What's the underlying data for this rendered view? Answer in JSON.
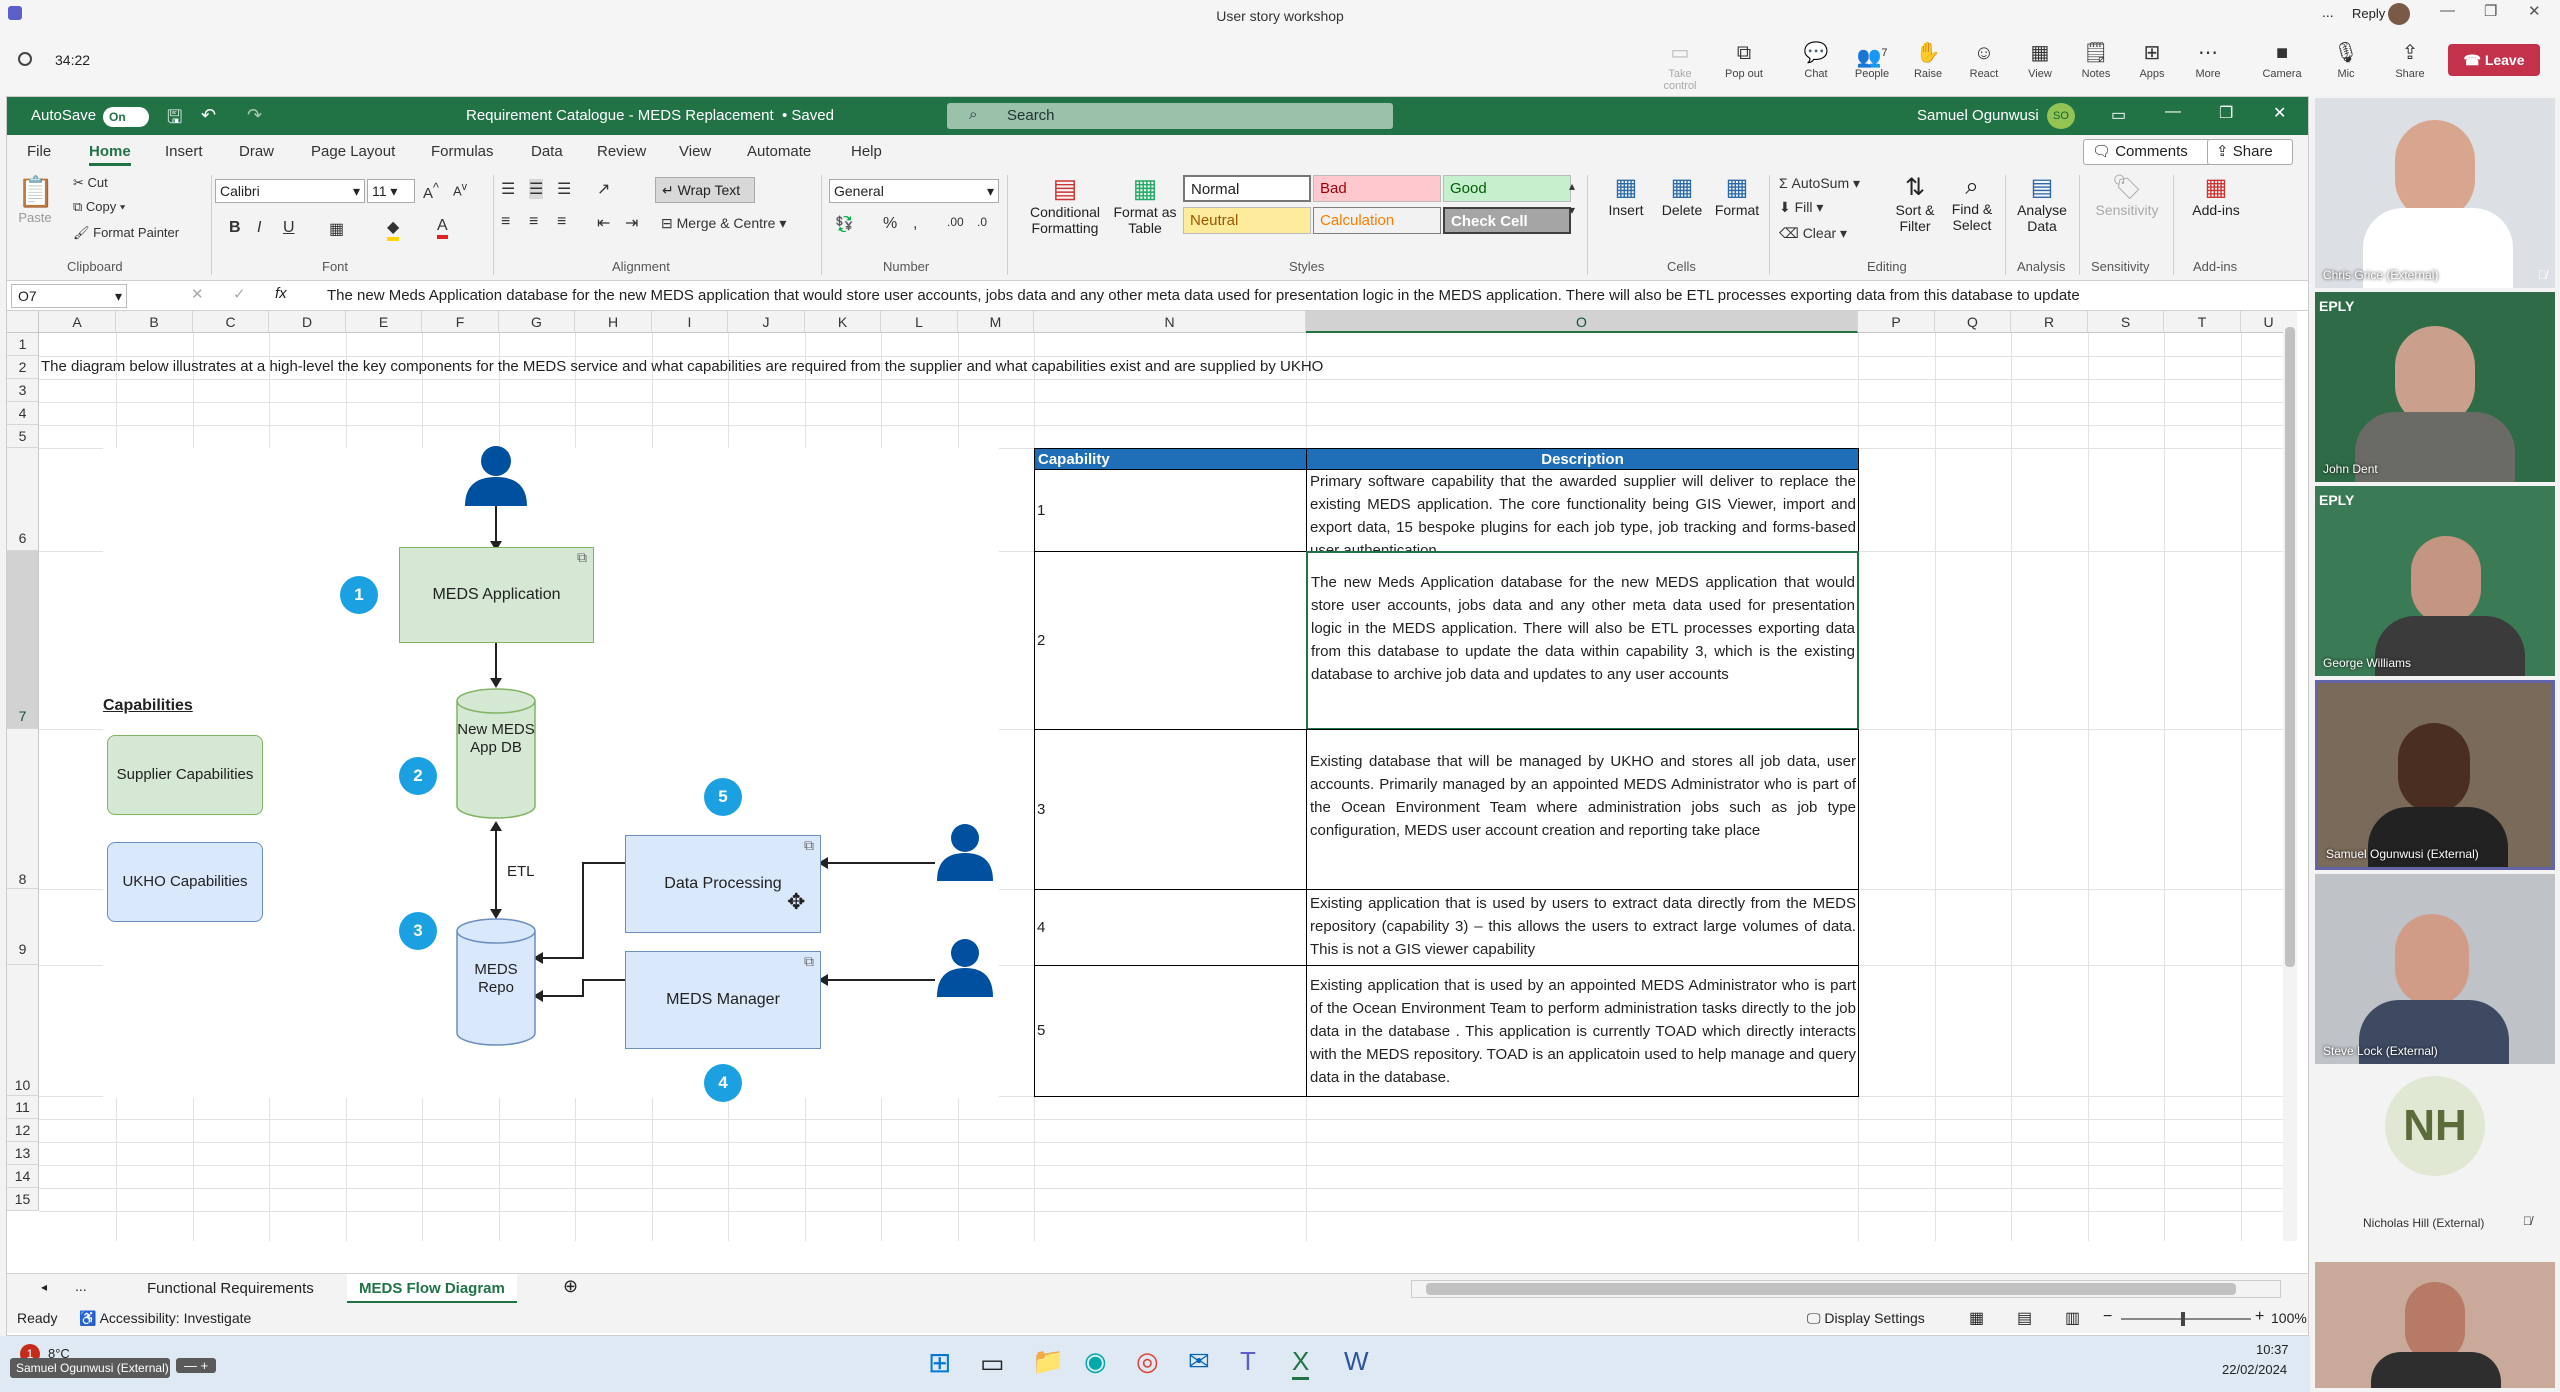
{
  "teams": {
    "meeting_title": "User story workshop",
    "timer": "34:22",
    "more": "...",
    "reply_label": "Reply",
    "buttons": [
      {
        "label": "Take control",
        "icon": "take-control-icon",
        "disabled": true
      },
      {
        "label": "Pop out",
        "icon": "pop-out-icon"
      },
      {
        "label": "Chat",
        "icon": "chat-icon"
      },
      {
        "label": "People",
        "icon": "people-icon",
        "count": "7"
      },
      {
        "label": "Raise",
        "icon": "raise-hand-icon"
      },
      {
        "label": "React",
        "icon": "react-icon"
      },
      {
        "label": "View",
        "icon": "view-icon"
      },
      {
        "label": "Notes",
        "icon": "notes-icon"
      },
      {
        "label": "Apps",
        "icon": "apps-icon"
      },
      {
        "label": "More",
        "icon": "more-icon"
      },
      {
        "label": "Camera",
        "icon": "camera-icon"
      },
      {
        "label": "Mic",
        "icon": "mic-icon"
      },
      {
        "label": "Share",
        "icon": "share-icon"
      }
    ],
    "leave": "Leave"
  },
  "excel": {
    "autosave": "AutoSave",
    "autosave_state": "On",
    "doc_title": "Requirement Catalogue - MEDS Replacement",
    "saved": "• Saved",
    "search_placeholder": "Search",
    "user": "Samuel Ogunwusi",
    "user_initials": "SO",
    "menu": [
      "File",
      "Home",
      "Insert",
      "Draw",
      "Page Layout",
      "Formulas",
      "Data",
      "Review",
      "View",
      "Automate",
      "Help"
    ],
    "active_menu": "Home",
    "comments": "Comments",
    "share": "Share",
    "ribbon": {
      "paste": "Paste",
      "cut": "Cut",
      "copy": "Copy",
      "format_painter": "Format Painter",
      "clipboard": "Clipboard",
      "font_name": "Calibri",
      "font_size": "11",
      "font": "Font",
      "wrap_text": "Wrap Text",
      "merge_centre": "Merge & Centre",
      "alignment": "Alignment",
      "number_format": "General",
      "number": "Number",
      "conditional_formatting": "Conditional Formatting",
      "format_as_table": "Format as Table",
      "styles": "Styles",
      "style_normal": "Normal",
      "style_bad": "Bad",
      "style_good": "Good",
      "style_neutral": "Neutral",
      "style_calculation": "Calculation",
      "style_check_cell": "Check Cell",
      "insert": "Insert",
      "delete": "Delete",
      "format": "Format",
      "cells": "Cells",
      "autosum": "AutoSum",
      "fill": "Fill",
      "clear": "Clear",
      "sort_filter": "Sort & Filter",
      "find_select": "Find & Select",
      "editing": "Editing",
      "analyse_data": "Analyse Data",
      "analysis": "Analysis",
      "sensitivity": "Sensitivity",
      "add_ins": "Add-ins"
    },
    "name_box": "O7",
    "formula": "The new Meds Application database for the new MEDS application that would store user accounts, jobs data and any other meta data used for presentation logic in the MEDS application. There will also be ETL processes exporting data from this database to update",
    "columns": [
      "A",
      "B",
      "C",
      "D",
      "E",
      "F",
      "G",
      "H",
      "I",
      "J",
      "K",
      "L",
      "M",
      "N",
      "O",
      "P",
      "Q",
      "R",
      "S",
      "T",
      "U"
    ],
    "rows": [
      "1",
      "2",
      "3",
      "4",
      "5",
      "6",
      "7",
      "8",
      "9",
      "10",
      "11",
      "12",
      "13",
      "14",
      "15"
    ],
    "intro_text": "The diagram below illustrates at a high-level the key components for the MEDS service and what capabilities are required from the supplier and what capabilities exist and  are supplied by UKHO",
    "table": {
      "header_capability": "Capability",
      "header_description": "Description",
      "rows": [
        {
          "num": "1",
          "desc": "Primary software capability that the awarded supplier will deliver to replace the existing MEDS application. The core functionality being GIS Viewer, import and export data, 15 bespoke plugins for each job type, job tracking and forms-based user authentication"
        },
        {
          "num": "2",
          "desc": "The new Meds Application database for the new MEDS application that would store user accounts, jobs data and any other meta data used for presentation logic in the MEDS application. There will also be ETL processes exporting data from this database to update the data within capability 3, which is the existing database to archive job data and updates to any user accounts"
        },
        {
          "num": "3",
          "desc": "Existing database that will be managed by UKHO and stores all job data, user accounts.  Primarily managed by an appointed MEDS Administrator who is part of the Ocean Environment Team where administration jobs such as job type configuration, MEDS user account creation and reporting take place"
        },
        {
          "num": "4",
          "desc": "Existing application that is used by users to extract data directly from the MEDS repository (capability 3) – this allows the users to extract large volumes of data. This is not a GIS viewer capability"
        },
        {
          "num": "5",
          "desc": "Existing application that is used by an appointed MEDS Administrator who is part of the Ocean Environment Team to perform administration tasks directly to the job data in the database . This application is currently TOAD which directly interacts with the MEDS repository. TOAD is an applicatoin used to help manage and query data in the database."
        }
      ]
    },
    "diagram": {
      "meds_application": "MEDS Application",
      "new_meds_app_db": "New MEDS App DB",
      "meds_repo": "MEDS Repo",
      "data_processing": "Data Processing",
      "meds_manager": "MEDS Manager",
      "etl": "ETL",
      "capabilities_title": "Capabilities",
      "supplier_capabilities": "Supplier Capabilities",
      "ukho_capabilities": "UKHO Capabilities",
      "n1": "1",
      "n2": "2",
      "n3": "3",
      "n4": "4",
      "n5": "5",
      "green_fill": "#d5e8d4",
      "blue_fill": "#dae8fc",
      "person_color": "#0050a0"
    },
    "sheet_tabs": [
      "Functional Requirements",
      "MEDS Flow Diagram"
    ],
    "active_sheet": "MEDS Flow Diagram",
    "tabs_more": "...",
    "status_ready": "Ready",
    "accessibility": "Accessibility: Investigate",
    "display_settings": "Display Settings",
    "zoom": "100%"
  },
  "participants": [
    {
      "name": "Chris Grice (External)",
      "muted": true
    },
    {
      "name": "John Dent",
      "muted": false
    },
    {
      "name": "George Williams",
      "muted": false
    },
    {
      "name": "Samuel Ogunwusi (External)",
      "muted": false
    },
    {
      "name": "Steve Lock (External)",
      "muted": false
    },
    {
      "name": "Nicholas Hill (External)",
      "initials": "NH",
      "muted": true
    }
  ],
  "taskbar": {
    "temperature": "8°C",
    "notification_count": "1",
    "sharing_label": "Samuel Ogunwusi (External)",
    "time": "10:37",
    "date": "22/02/2024"
  }
}
